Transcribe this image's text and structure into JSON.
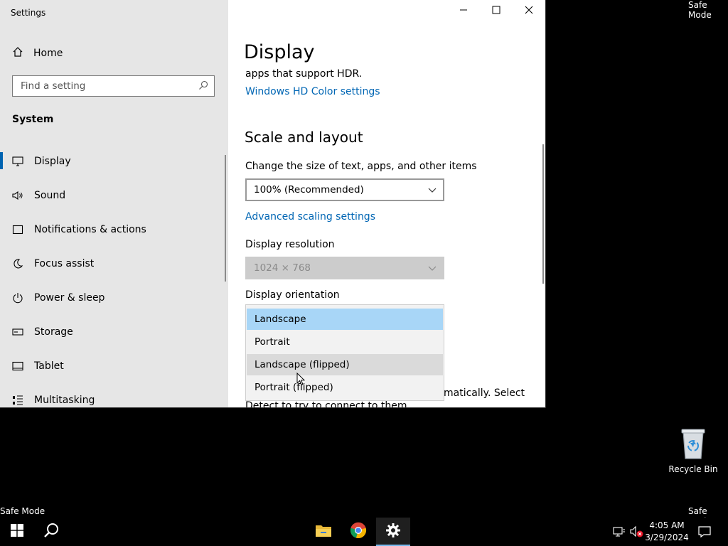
{
  "desktop": {
    "safe_mode_top_right": "Safe Mode",
    "safe_mode_bottom_left": "Safe Mode",
    "safe_mode_bottom_right": "Safe Mode",
    "recycle_bin_label": "Recycle Bin"
  },
  "window": {
    "title": "Settings",
    "controls": [
      "minimize-icon",
      "maximize-icon",
      "close-icon"
    ]
  },
  "sidebar": {
    "home_label": "Home",
    "search_placeholder": "Find a setting",
    "section_label": "System",
    "items": [
      {
        "label": "Display",
        "icon": "monitor-icon",
        "active": true
      },
      {
        "label": "Sound",
        "icon": "speaker-icon"
      },
      {
        "label": "Notifications & actions",
        "icon": "notification-icon"
      },
      {
        "label": "Focus assist",
        "icon": "moon-icon"
      },
      {
        "label": "Power & sleep",
        "icon": "power-icon"
      },
      {
        "label": "Storage",
        "icon": "storage-icon"
      },
      {
        "label": "Tablet",
        "icon": "tablet-icon"
      },
      {
        "label": "Multitasking",
        "icon": "multitasking-icon"
      }
    ]
  },
  "main": {
    "title": "Display",
    "hdr_text": "apps that support HDR.",
    "hdr_link": "Windows HD Color settings",
    "scale_heading": "Scale and layout",
    "scale_label": "Change the size of text, apps, and other items",
    "scale_value": "100% (Recommended)",
    "advanced_scaling_link": "Advanced scaling settings",
    "resolution_label": "Display resolution",
    "resolution_value": "1024 × 768",
    "orientation_label": "Display orientation",
    "orientation_options": [
      "Landscape",
      "Portrait",
      "Landscape (flipped)",
      "Portrait (flipped)"
    ],
    "orientation_selected": "Landscape",
    "orientation_hovered": "Landscape (flipped)",
    "partial_text_1": "matically. Select",
    "partial_text_2": "Detect to try to connect to them."
  },
  "taskbar": {
    "apps": [
      "start-icon",
      "search-icon",
      "file-explorer-icon",
      "chrome-icon",
      "settings-icon"
    ],
    "active_app": "settings-icon",
    "time": "4:05 AM",
    "date": "3/29/2024"
  },
  "colors": {
    "accent": "#0063b1",
    "link": "#0066b4",
    "selected_option": "#a8d6f7",
    "sidebar_bg": "#e6e6e6"
  }
}
